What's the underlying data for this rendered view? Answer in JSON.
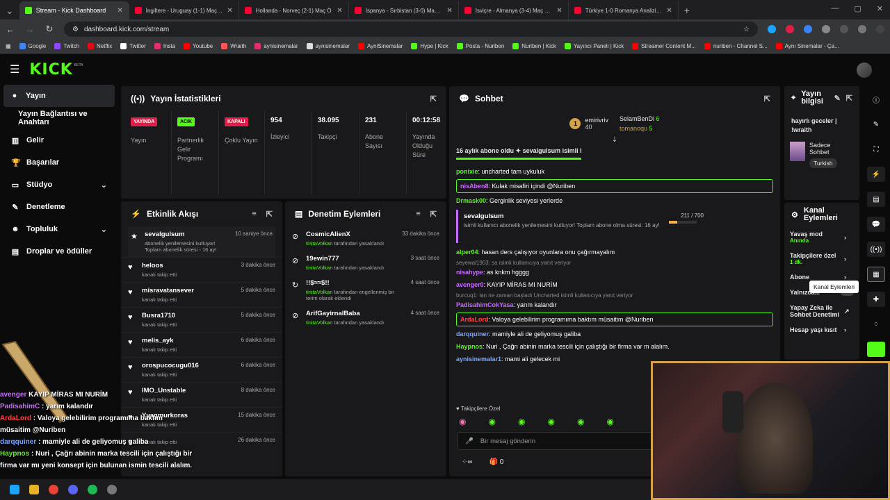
{
  "browser": {
    "tabs": [
      {
        "label": "Stream - Kick Dashboard",
        "color": "#53fc18",
        "active": true
      },
      {
        "label": "İngiltere - Uruguay (1-1) Maç Ö",
        "color": "#ff0033"
      },
      {
        "label": "Hollanda - Norveç (2-1) Maç Ö",
        "color": "#ff0033"
      },
      {
        "label": "İspanya - Sırbistan (3-0) Maç Ö",
        "color": "#ff0033"
      },
      {
        "label": "İsviçre - Almanya (3-4) Maç Öze",
        "color": "#ff0033"
      },
      {
        "label": "Türkiye 1-0 Romanya Analizi - Y",
        "color": "#ff0033"
      }
    ],
    "url": "dashboard.kick.com/stream",
    "bookmarks": [
      "Google",
      "Twitch",
      "Netflix",
      "Twitter",
      "Insta",
      "Youtube",
      "Wraith",
      "aynisinemalar",
      "aynisinemalar",
      "AyniSinemalar",
      "Hype | Kick",
      "Posta - Nuriben",
      "Nuriben | Kick",
      "Yayıncı Paneli | Kick",
      "Streamer Content M...",
      "nuriben - Channel S...",
      "Aynı Sinemalar - Ça..."
    ]
  },
  "header": {
    "logo": "KICK",
    "beta": "BETA"
  },
  "sidebar": {
    "items": [
      {
        "label": "Yayın",
        "icon": "●",
        "active": true
      },
      {
        "label": "Yayın Bağlantısı ve Anahtarı",
        "sub": true
      },
      {
        "label": "Gelir",
        "icon": "▥"
      },
      {
        "label": "Başarılar",
        "icon": "🏆"
      },
      {
        "label": "Stüdyo",
        "icon": "▭",
        "chevron": true
      },
      {
        "label": "Denetleme",
        "icon": "✎"
      },
      {
        "label": "Topluluk",
        "icon": "☻",
        "chevron": true
      },
      {
        "label": "Droplar ve ödüller",
        "icon": "▤"
      }
    ]
  },
  "stats": {
    "title": "Yayın İstatistikleri",
    "items": [
      {
        "badge": "YAYINDA",
        "badge_color": "#e11d48",
        "label": "Yayın"
      },
      {
        "badge": "ACIK",
        "badge_color": "#53fc18",
        "label": "Partnerlik Gelir Programı"
      },
      {
        "badge": "KAPALI",
        "badge_color": "#e11d48",
        "label": "Çoklu Yayın"
      },
      {
        "value": "954",
        "label": "İzleyici"
      },
      {
        "value": "38.095",
        "label": "Takipçi"
      },
      {
        "value": "231",
        "label": "Abone Sayısı"
      },
      {
        "value": "00:12:58",
        "label": "Yayında Olduğu Süre"
      }
    ]
  },
  "activity": {
    "title": "Etkinlik Akışı",
    "items": [
      {
        "name": "sevalgulsum",
        "sub": "abonelik yenilemesini kutluyor! Toplam abonelik süresi - 16 ay!",
        "time": "10 saniye önce",
        "icon": "★"
      },
      {
        "name": "heloos",
        "sub": "kanalı takip etti",
        "time": "3 dakika önce",
        "icon": "♥"
      },
      {
        "name": "misravatansever",
        "sub": "kanalı takip etti",
        "time": "5 dakika önce",
        "icon": "♥"
      },
      {
        "name": "Busra1710",
        "sub": "kanalı takip etti",
        "time": "5 dakika önce",
        "icon": "♥"
      },
      {
        "name": "melis_ayk",
        "sub": "kanalı takip etti",
        "time": "6 dakika önce",
        "icon": "♥"
      },
      {
        "name": "orospucocugu016",
        "sub": "kanalı takip etti",
        "time": "6 dakika önce",
        "icon": "♥"
      },
      {
        "name": "IMO_Unstable",
        "sub": "kanalı takip etti",
        "time": "8 dakika önce",
        "icon": "♥"
      },
      {
        "name": "Yyagmurkoras",
        "sub": "kanalı takip etti",
        "time": "15 dakika önce",
        "icon": "♥"
      },
      {
        "name": "",
        "sub": "kanalı takip etti",
        "time": "26 dakika önce",
        "icon": "♥"
      }
    ]
  },
  "moderation": {
    "title": "Denetim Eylemleri",
    "items": [
      {
        "name": "CosmicAlienX",
        "by": "tinitaVolkan",
        "sub": "tarafından yasaklandı",
        "time": "33 dakika önce",
        "icon": "⊘"
      },
      {
        "name": "19ewin777",
        "by": "tinitaVolkan",
        "sub": "tarafından yasaklandı",
        "time": "3 saat önce",
        "icon": "⊘"
      },
      {
        "name": "!!$≈≈$!!",
        "by": "tinitaVolkan",
        "sub": "tarafından engellenmiş bir terim olarak eklendi",
        "time": "4 saat önce",
        "icon": "↻"
      },
      {
        "name": "ArifGayirnalBaba",
        "by": "tinitaVolkan",
        "sub": "tarafından yasaklandı",
        "time": "4 saat önce",
        "icon": "⊘"
      }
    ]
  },
  "chat": {
    "title": "Sohbet",
    "top": [
      {
        "rank": "1",
        "name": "emirivriv",
        "count": "40"
      },
      {
        "name": "SelamBenDi",
        "count": "6"
      },
      {
        "name": "tomanoqu",
        "count": "5"
      }
    ],
    "ticker": "16 aylık abone oldu ✦ sevalgulsum isimli kullanıcı 16 aylık abone oldu ✦ sevalgulsum isimli kullanıcı",
    "messages": [
      {
        "user": "ponixie",
        "color": "#53fc18",
        "text": ": uncharted tam uykuluk"
      },
      {
        "user": "nisAben8",
        "color": "#c86bff",
        "text": ": Kulak misafiri içindi @Nuriben",
        "hl": true
      },
      {
        "user": "Drmask00",
        "color": "#53fc18",
        "text": ": Gerginlik seviyesi yerlerde"
      },
      {
        "user": "sevalgulsum",
        "color": "#fff",
        "text": "isimli kullanıcı abonelik yenilemesini kutluyor! Toplam abone olma süresi: 16 ay!",
        "sub": true,
        "progress": "211 / 700",
        "progress_frac": 0.3
      },
      {
        "user": "alper04",
        "color": "#53fc18",
        "text": ": hasan ders çalışıyor oyunlara onu çağırmayalım"
      },
      {
        "reply": "seyewal1903: sa isimli kullanıcıya yanıt veriyor"
      },
      {
        "user": "nisahype",
        "color": "#c86bff",
        "text": ": as knkm hgggg"
      },
      {
        "user": "avenger0",
        "color": "#c86bff",
        "text": ": KAYIP MİRAS MI NURİM"
      },
      {
        "reply": "burcuq1: lan ne zaman başladı Uncharted isimli kullanıcıya yanıt veriyor"
      },
      {
        "user": "PadisahimCokYasa",
        "color": "#c86bff",
        "text": ": yarım kalandır"
      },
      {
        "user": "ArdaLord",
        "color": "#ff4444",
        "text": ": Valoya gelebilirim programıma baktım müsaitim @Nuriben",
        "hl": true
      },
      {
        "user": "darqquiner",
        "color": "#7aa7ff",
        "text": ": mamiyle ali de geliyomuş galiba"
      },
      {
        "user": "Haypnos",
        "color": "#53fc18",
        "text": ": Nuri , Çağrı abinin marka tescili için çalıştığı bir firma var m alalım."
      },
      {
        "user": "aynisinemalar1",
        "color": "#7aa7ff",
        "text": ": mami ali gelecek mi"
      }
    ],
    "followers_only": "Takipçilere Özel",
    "placeholder": "Bir mesaj gönderin",
    "count": "0"
  },
  "info": {
    "title": "Yayın bilgisi",
    "stream_title": "hayırlı geceler | !wraith",
    "category": "Sadece Sohbet",
    "tag": "Turkish"
  },
  "channel_actions": {
    "title": "Kanal Eylemleri",
    "items": [
      {
        "label": "Yavaş mod",
        "sub": "Anında"
      },
      {
        "label": "Takipçilere özel",
        "sub": "1 dk."
      },
      {
        "label": "Abone"
      },
      {
        "label": "Yalnızca..."
      },
      {
        "label": "Yapay Zeka ile Sohbet Denetimi"
      },
      {
        "label": "Hesap yaşı kısıt"
      }
    ],
    "tooltip": "Kanal Eylemleri"
  },
  "overlay": {
    "lines": [
      {
        "user": "avenger",
        "text": "KAYIP MİRAS MI NURİM"
      },
      {
        "user": "PadisahimC",
        "text": ": yarım kalandır"
      },
      {
        "user": "ArdaLord",
        "text": ": Valoya gelebilirim programıma baktım müsaitim @Nuriben"
      },
      {
        "user": "darqquiner",
        "text": ": mamiyle ali de geliyomuş galiba"
      },
      {
        "user": "Haypnos",
        "text": ": Nuri , Çağrı abinin marka tescili için çalıştığı bir firma var mı yeni konsept için bulunan ismin tescili alalım."
      }
    ]
  }
}
